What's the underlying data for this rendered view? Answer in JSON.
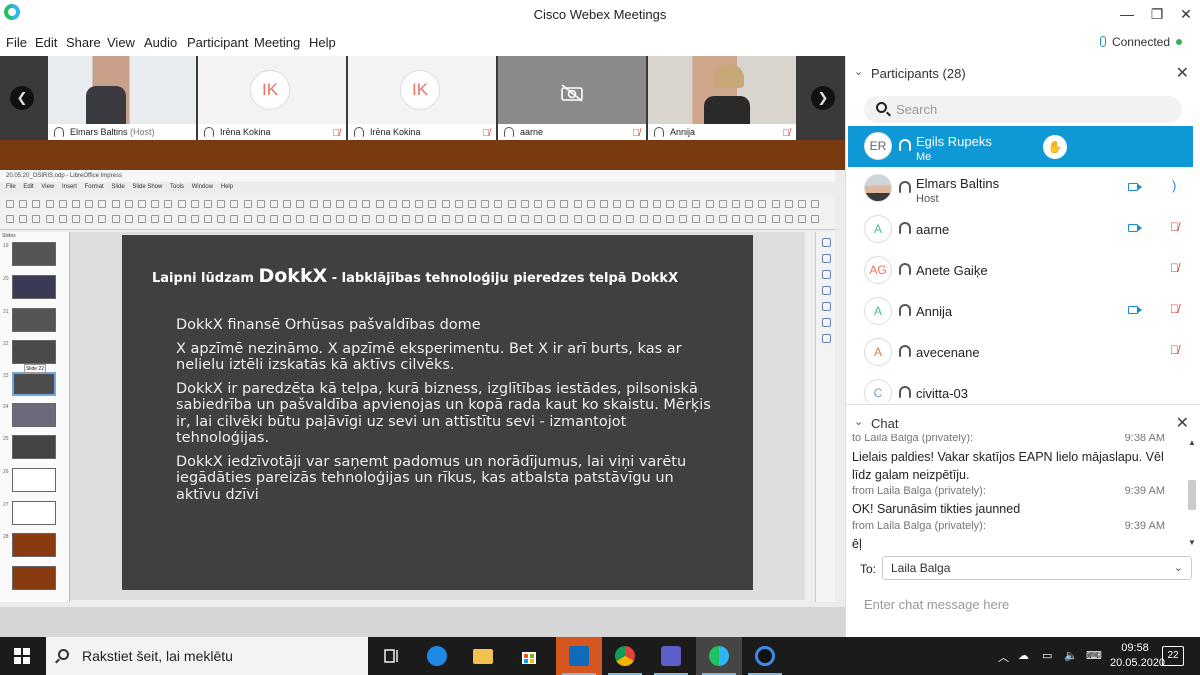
{
  "window": {
    "title": "Cisco Webex Meetings",
    "minimize": "—",
    "restore": "❐",
    "close": "✕"
  },
  "menu": [
    "File",
    "Edit",
    "Share",
    "View",
    "Audio",
    "Participant",
    "Meeting",
    "Help"
  ],
  "connection": {
    "status": "Connected",
    "color": "#34b34a"
  },
  "video_strip": {
    "tiles": [
      {
        "name": "Elmars Baltins",
        "role": "(Host)",
        "type": "video"
      },
      {
        "name": "Irēna Kokina",
        "initials": "IK",
        "type": "initials"
      },
      {
        "name": "Irēna Kokina",
        "initials": "IK",
        "type": "initials"
      },
      {
        "name": "aarne",
        "type": "camera-off"
      },
      {
        "name": "Annija",
        "type": "video"
      }
    ]
  },
  "libreoffice": {
    "title": "20.05.20_OSIRIS.odp - LibreOffice Impress",
    "menu": [
      "File",
      "Edit",
      "View",
      "Insert",
      "Format",
      "Slide",
      "Slide Show",
      "Tools",
      "Window",
      "Help"
    ],
    "slides_label": "Slides",
    "slide_numbers": [
      "19",
      "20",
      "21",
      "22",
      "23",
      "24",
      "25",
      "26",
      "27",
      "28"
    ],
    "tooltip": "Slide 22",
    "slide": {
      "title_prefix": "Laipni lūdzam ",
      "title_big": "DokkX",
      "title_suffix": " - labklājības tehnoloģiju pieredzes telpā DokkX",
      "paragraphs": [
        "DokkX finansē Orhūsas pašvaldības dome",
        "X apzīmē nezināmo. X apzīmē eksperimentu. Bet X ir arī burts, kas ar nelielu iztēli izskatās kā aktīvs cilvēks.",
        "DokkX ir paredzēta kā telpa, kurā bizness, izglītības iestādes, pilsoniskā sabiedrība un pašvaldība apvienojas un kopā rada kaut ko skaistu. Mērķis ir, lai cilvēki būtu paļāvīgi uz sevi un attīstītu sevi - izmantojot tehnoloģijas.",
        "DokkX iedzīvotāji var saņemt padomus un norādījumus, lai viņi varētu iegādāties pareizās tehnoloģijas un rīkus, kas atbalsta patstāvīgu un aktīvu dzīvi"
      ]
    }
  },
  "participants": {
    "title": "Participants (28)",
    "search_placeholder": "Search",
    "list": [
      {
        "initials": "ER",
        "name": "Egils Rupeks",
        "role": "Me",
        "me": true
      },
      {
        "initials": "",
        "name": "Elmars Baltins",
        "role": "Host",
        "photo": true
      },
      {
        "initials": "A",
        "name": "aarne",
        "role": ""
      },
      {
        "initials": "AG",
        "name": "Anete Gaiķe",
        "role": ""
      },
      {
        "initials": "A",
        "name": "Annija",
        "role": ""
      },
      {
        "initials": "A",
        "name": "avecenane",
        "role": ""
      },
      {
        "initials": "C",
        "name": "civitta-03",
        "role": ""
      }
    ]
  },
  "chat": {
    "title": "Chat",
    "messages": [
      {
        "meta": "to Laila Balga (privately):",
        "time": "9:38 AM"
      },
      {
        "text": "Lielais paldies! Vakar skatījos EAPN lielo mājaslapu. Vēl līdz galam neizpētīju."
      },
      {
        "meta": "from Laila Balga (privately):",
        "time": "9:39 AM"
      },
      {
        "text": "OK! Sarunāsim tikties jaunned"
      },
      {
        "meta": "from Laila Balga (privately):",
        "time": "9:39 AM"
      },
      {
        "text": "ēļ"
      }
    ],
    "to_label": "To:",
    "to_value": "Laila Balga",
    "input_placeholder": "Enter chat message here"
  },
  "taskbar": {
    "search_placeholder": "Rakstiet šeit, lai meklētu",
    "time": "09:58",
    "date": "20.05.2020",
    "notifications": "22"
  }
}
